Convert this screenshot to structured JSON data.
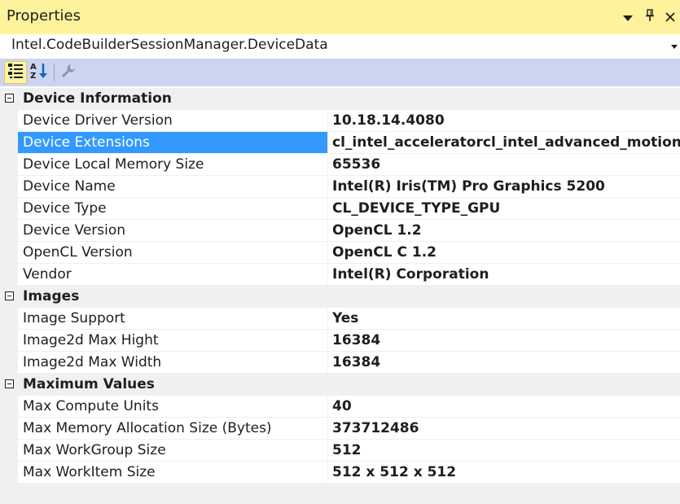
{
  "window": {
    "title": "Properties"
  },
  "object_selector": {
    "value": "Intel.CodeBuilderSessionManager.DeviceData"
  },
  "toolbar": {
    "categorized": "categorized-icon",
    "alphabetical": "alphabetical-icon",
    "property_pages": "property-pages-icon"
  },
  "categories": [
    {
      "label": "Device Information",
      "properties": [
        {
          "name": "Device Driver Version",
          "value": "10.18.14.4080"
        },
        {
          "name": "Device Extensions",
          "value": "cl_intel_acceleratorcl_intel_advanced_motion_estim"
        },
        {
          "name": "Device Local Memory Size",
          "value": "65536"
        },
        {
          "name": "Device Name",
          "value": "Intel(R) Iris(TM) Pro Graphics 5200"
        },
        {
          "name": "Device Type",
          "value": "CL_DEVICE_TYPE_GPU"
        },
        {
          "name": "Device Version",
          "value": "OpenCL 1.2"
        },
        {
          "name": "OpenCL Version",
          "value": "OpenCL C 1.2"
        },
        {
          "name": "Vendor",
          "value": "Intel(R) Corporation"
        }
      ]
    },
    {
      "label": "Images",
      "properties": [
        {
          "name": "Image Support",
          "value": "Yes"
        },
        {
          "name": "Image2d Max Hight",
          "value": "16384"
        },
        {
          "name": "Image2d Max Width",
          "value": "16384"
        }
      ]
    },
    {
      "label": "Maximum Values",
      "properties": [
        {
          "name": "Max Compute Units",
          "value": "40"
        },
        {
          "name": "Max Memory Allocation Size (Bytes)",
          "value": "373712486"
        },
        {
          "name": "Max WorkGroup Size",
          "value": "512"
        },
        {
          "name": "Max WorkItem Size",
          "value": "512 x 512 x 512"
        }
      ]
    }
  ],
  "selected_property": "Device Extensions",
  "colors": {
    "title_bar": "#fff29d",
    "toolbar": "#ccd5f0",
    "selection": "#3399ff",
    "category_bg": "#f0f0f0"
  }
}
